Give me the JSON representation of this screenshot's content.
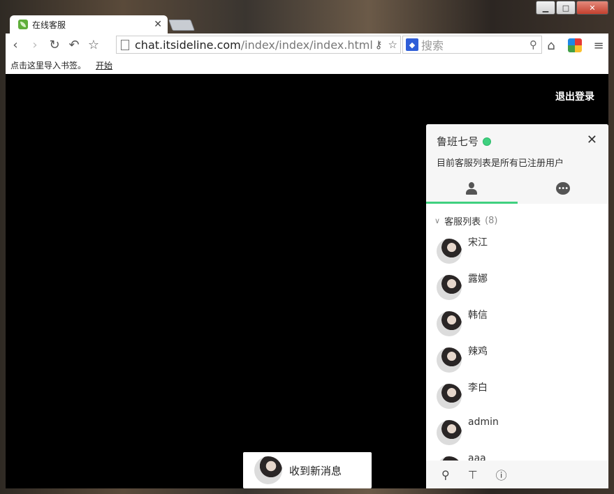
{
  "browser": {
    "tab_title": "在线客服",
    "url_host": "chat.itsideline.com",
    "url_path": "/index/index/index.html",
    "search_placeholder": "搜索",
    "bookmark_hint": "点击这里导入书签。",
    "bookmark_link": "开始"
  },
  "page": {
    "logout_label": "退出登录"
  },
  "panel": {
    "user_name": "鲁班七号",
    "subtitle": "目前客服列表是所有已注册用户",
    "group_title": "客服列表",
    "group_count": "(8)",
    "contacts": [
      {
        "name": "宋江"
      },
      {
        "name": "露娜"
      },
      {
        "name": "韩信"
      },
      {
        "name": "辣鸡"
      },
      {
        "name": "李白"
      },
      {
        "name": "admin"
      },
      {
        "name": "aaa"
      }
    ]
  },
  "notification": {
    "text": "收到新消息"
  },
  "colors": {
    "accent": "#3fd07f",
    "page_bg": "#000000"
  }
}
